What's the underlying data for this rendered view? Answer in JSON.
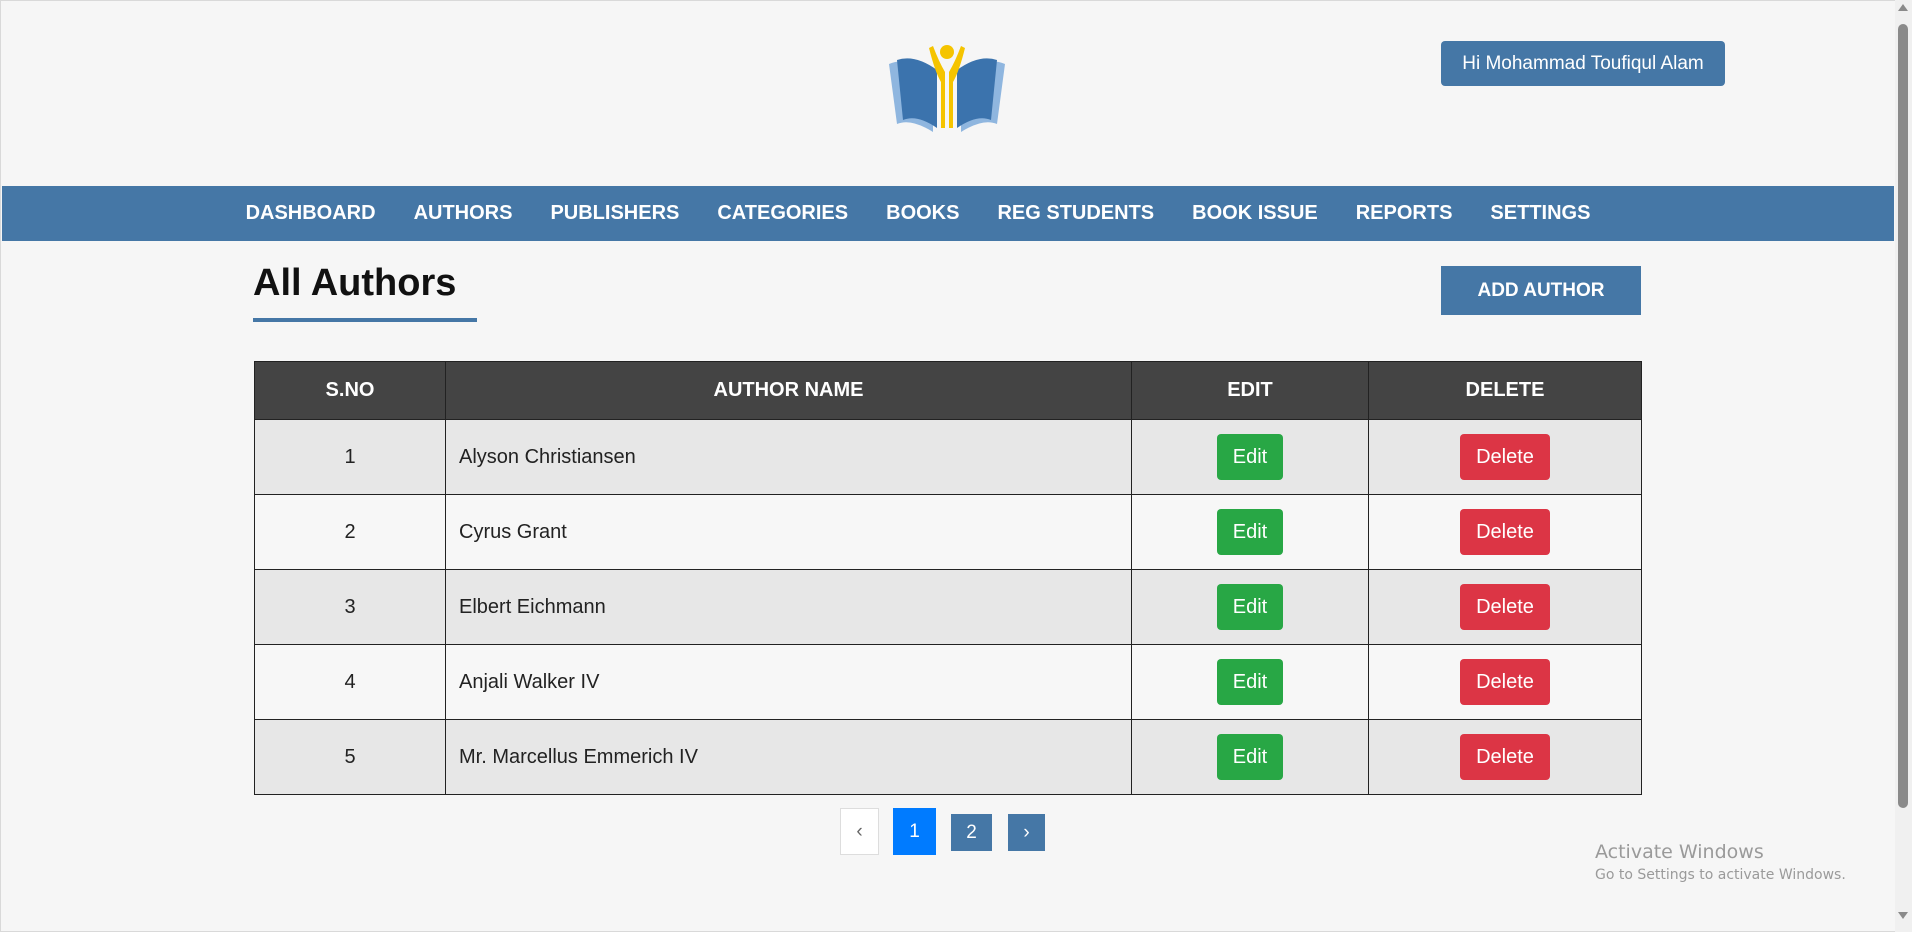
{
  "header": {
    "logo_icon": "open-book-reader-logo",
    "user_greeting": "Hi Mohammad Toufiqul Alam"
  },
  "nav": {
    "items": [
      {
        "label": "DASHBOARD"
      },
      {
        "label": "AUTHORS"
      },
      {
        "label": "PUBLISHERS"
      },
      {
        "label": "CATEGORIES"
      },
      {
        "label": "BOOKS"
      },
      {
        "label": "REG STUDENTS"
      },
      {
        "label": "BOOK ISSUE"
      },
      {
        "label": "REPORTS"
      },
      {
        "label": "SETTINGS"
      }
    ]
  },
  "main": {
    "title": "All Authors",
    "add_button": "ADD AUTHOR",
    "table": {
      "headers": [
        "S.NO",
        "AUTHOR NAME",
        "EDIT",
        "DELETE"
      ],
      "rows": [
        {
          "sno": "1",
          "name": "Alyson Christiansen",
          "edit": "Edit",
          "delete": "Delete"
        },
        {
          "sno": "2",
          "name": "Cyrus Grant",
          "edit": "Edit",
          "delete": "Delete"
        },
        {
          "sno": "3",
          "name": "Elbert Eichmann",
          "edit": "Edit",
          "delete": "Delete"
        },
        {
          "sno": "4",
          "name": "Anjali Walker IV",
          "edit": "Edit",
          "delete": "Delete"
        },
        {
          "sno": "5",
          "name": "Mr. Marcellus Emmerich IV",
          "edit": "Edit",
          "delete": "Delete"
        }
      ]
    },
    "pagination": {
      "prev": "‹",
      "pages": [
        "1",
        "2"
      ],
      "current_page": 1,
      "next": "›"
    }
  },
  "watermark": {
    "line1": "Activate Windows",
    "line2": "Go to Settings to activate Windows."
  },
  "colors": {
    "primary": "#4577a6",
    "table_header": "#444444",
    "edit": "#28a745",
    "delete": "#dc3545",
    "active_page": "#007bff",
    "background": "#f6f6f6"
  }
}
